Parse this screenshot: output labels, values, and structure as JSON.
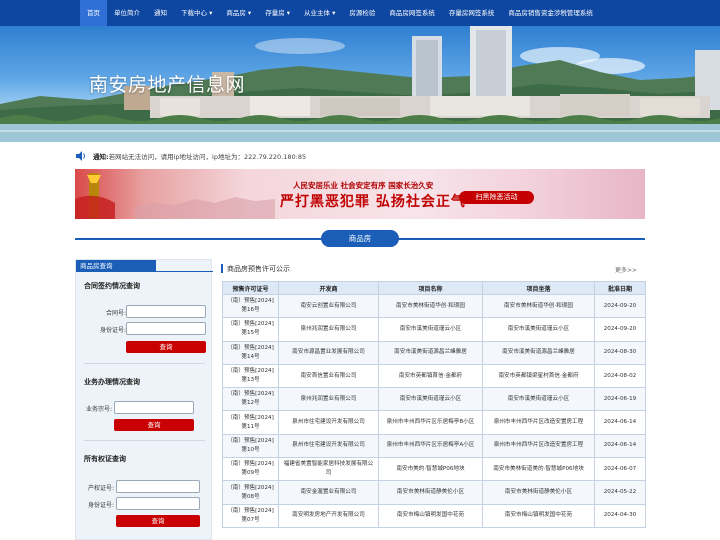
{
  "nav": {
    "items": [
      {
        "label": "首页",
        "active": true
      },
      {
        "label": "单位简介"
      },
      {
        "label": "通知"
      },
      {
        "label": "下载中心 ▾"
      },
      {
        "label": "商品房 ▾"
      },
      {
        "label": "存量房 ▾"
      },
      {
        "label": "从业主体 ▾"
      },
      {
        "label": "房源检验"
      },
      {
        "label": "商品房网签系统"
      },
      {
        "label": "存量房网签系统"
      },
      {
        "label": "商品房销售资金涉税管理系统"
      }
    ]
  },
  "banner": {
    "title": "南安房地产信息网"
  },
  "notice": {
    "label": "通知:",
    "text": "若网站无法访问，请用ip地址访问，ip地址为：222.79.220.180:85",
    "icon": "speaker-icon"
  },
  "ad": {
    "slogan_small": "人民安居乐业 社会安定有序 国家长治久安",
    "slogan_large": "严打黑恶犯罪 弘扬社会正气",
    "button": "扫黑除恶活动"
  },
  "section_tab": {
    "label": "商品房"
  },
  "left_panel": {
    "head": "商品房查询",
    "contract": {
      "title": "合同签约情况查询",
      "contract_no_label": "合同号:",
      "id_label": "身份证号:",
      "button": "查询"
    },
    "business": {
      "title": "业务办理情况查询",
      "business_no_label": "业务宗号:",
      "button": "查询"
    },
    "ownership": {
      "title": "所有权证查询",
      "cert_label": "产权证号:",
      "id_label": "身份证号:",
      "button": "查询"
    }
  },
  "permits": {
    "title": "商品房预售许可公示",
    "more": "更多>>",
    "columns": [
      "预售许可证号",
      "开发商",
      "项目名称",
      "项目坐落",
      "批准日期"
    ],
    "rows": [
      [
        "（南）预售[2024]第16号",
        "南安云创置业有限公司",
        "南安市美林街道华创·和璟园",
        "南安市美林街道华创·和璟园",
        "2024-09-20"
      ],
      [
        "（南）预售[2024]第15号",
        "泉州兆润置业有限公司",
        "南安市溪美街道瑾云小区",
        "南安市溪美街道瑾云小区",
        "2024-09-20"
      ],
      [
        "（南）预售[2024]第14号",
        "南安市源昌置业发展有限公司",
        "南安市溪美街道源昌兰峰雅居",
        "南安市溪美街道源昌兰峰雅居",
        "2024-08-30"
      ],
      [
        "（南）预售[2024]第13号",
        "南安首信置业有限公司",
        "南安市英都镇首信·金都府",
        "南安市英都镇梁星村首信·金都府",
        "2024-08-02"
      ],
      [
        "（南）预售[2024]第12号",
        "泉州兆润置业有限公司",
        "南安市溪美街道瑾云小区",
        "南安市溪美街道瑾云小区",
        "2024-06-19"
      ],
      [
        "（南）预售[2024]第11号",
        "泉州市住宅建设开发有限公司",
        "泉州市丰州西华片区乐居梅亭B小区",
        "泉州市丰州西华片区改造安置房工程",
        "2024-06-14"
      ],
      [
        "（南）预售[2024]第10号",
        "泉州市住宅建设开发有限公司",
        "泉州市丰州西华片区乐居梅亭A小区",
        "泉州市丰州西华片区改造安置房工程",
        "2024-06-14"
      ],
      [
        "（南）预售[2024]第09号",
        "福建省美置智能家居科技发展有限公司",
        "南安市美的·智慧城P06地块",
        "南安市美林街道美的·智慧城P06地块",
        "2024-06-07"
      ],
      [
        "（南）预售[2024]第08号",
        "南安金渥置业有限公司",
        "南安市美林街道静美伦小区",
        "南安市美林街道静美伦小区",
        "2024-05-22"
      ],
      [
        "（南）预售[2024]第07号",
        "南安明发房地产开发有限公司",
        "南安市梅山镇明发国中花苑",
        "南安市梅山镇明发国中花苑",
        "2024-04-30"
      ]
    ]
  }
}
